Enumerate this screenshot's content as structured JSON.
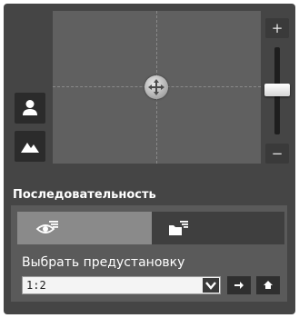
{
  "ptz": {
    "zoom_in_label": "+",
    "zoom_out_label": "−",
    "zoom_level": 0.49,
    "icons": {
      "move_handle": "move-arrows-icon",
      "person": "person-icon",
      "landscape": "landscape-icon"
    }
  },
  "sequence": {
    "title": "Последовательность",
    "tabs": [
      {
        "icon": "eye-list-icon",
        "active": true
      },
      {
        "icon": "folder-list-icon",
        "active": false
      }
    ],
    "preset_label": "Выбрать предустановку",
    "preset_value": "1:2",
    "buttons": {
      "go": "arrow-right-icon",
      "home": "home-icon"
    }
  },
  "colors": {
    "panel": "#454545",
    "pad": "#606060",
    "active_tab": "#8a8a8a",
    "inactive_tab": "#3f3f3f",
    "button": "#2b2b2b"
  }
}
